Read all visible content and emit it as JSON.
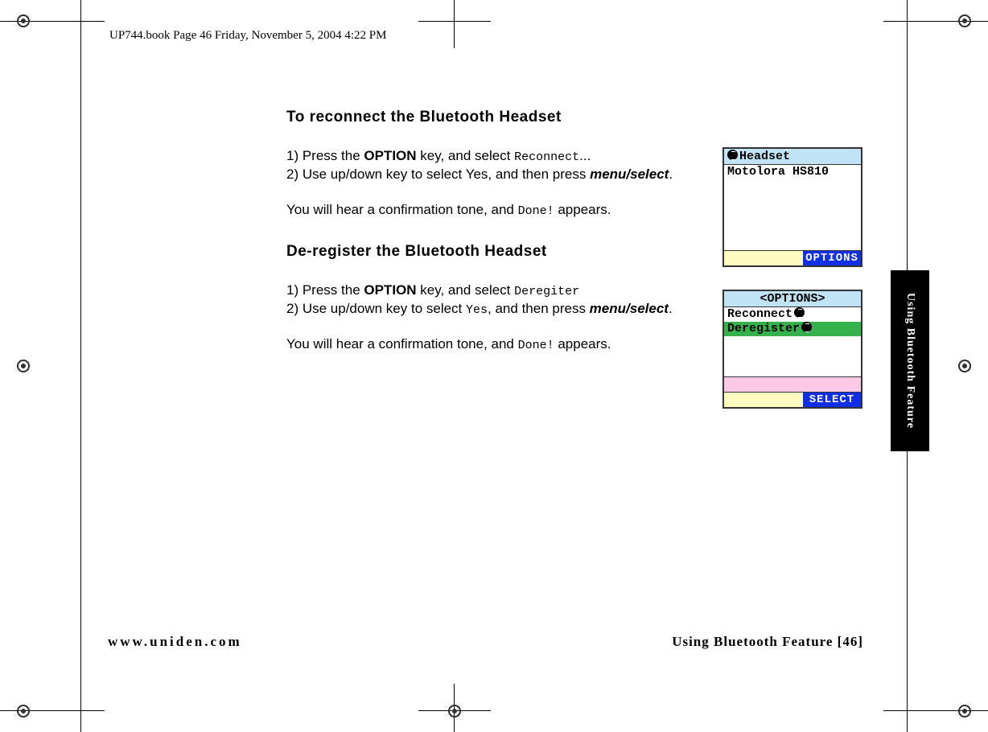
{
  "header_line": "UP744.book  Page 46  Friday, November 5, 2004  4:22 PM",
  "h_reconnect": "To reconnect the Bluetooth Headset",
  "s1_1_a": "1) Press the ",
  "s1_1_b": "OPTION",
  "s1_1_c": " key, and select ",
  "s1_1_d": "Reconnect",
  "s1_1_e": "...",
  "s1_2_a": "2) Use up/down key to select Yes, and then press ",
  "s1_2_b": "menu/select",
  "s1_2_c": ".",
  "s1_conf_a": "You will hear a confirmation tone, and ",
  "s1_conf_b": "Done!",
  "s1_conf_c": " appears.",
  "h_deregister": "De-register the Bluetooth Headset",
  "s2_1_a": "1) Press the ",
  "s2_1_b": "OPTION",
  "s2_1_c": " key, and select ",
  "s2_1_d": "Deregiter",
  "s2_2_a": "2) Use up/down key to select ",
  "s2_2_b": "Yes",
  "s2_2_c": ", and then press ",
  "s2_2_d": "menu/select",
  "s2_2_e": ".",
  "s2_conf_a": "You will hear a confirmation tone, and ",
  "s2_conf_b": "Done!",
  "s2_conf_c": " appears.",
  "footer_left": "www.uniden.com",
  "footer_right": "Using Bluetooth Feature [46]",
  "side_tab": "Using Bluetooth Feature",
  "screen1": {
    "title": "Headset",
    "row": "Motolora HS810",
    "btn": "OPTIONS"
  },
  "screen2": {
    "title": "<OPTIONS>",
    "row1": "Reconnect",
    "row2": "Deregister",
    "btn": "SELECT"
  }
}
